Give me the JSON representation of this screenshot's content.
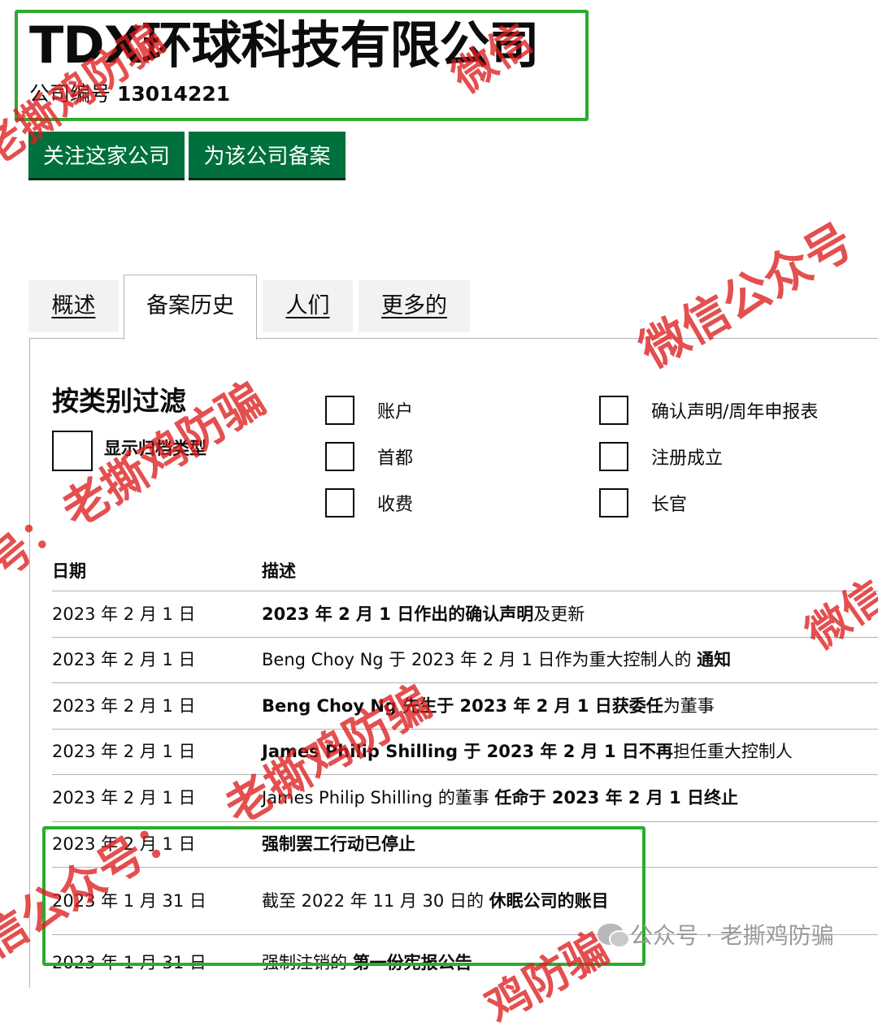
{
  "company": {
    "name": "TDX环球科技有限公司",
    "number_label": "公司编号",
    "number": "13014221"
  },
  "actions": {
    "follow_label": "关注这家公司",
    "file_label": "为该公司备案"
  },
  "tabs": [
    {
      "label": "概述",
      "active": false
    },
    {
      "label": "备案历史",
      "active": true
    },
    {
      "label": "人们",
      "active": false
    },
    {
      "label": "更多的",
      "active": false
    }
  ],
  "filter": {
    "title": "按类别过滤",
    "show_archive_label": "显示归档类型",
    "categories": [
      "账户",
      "首都",
      "收费",
      "确认声明/周年申报表",
      "注册成立",
      "长官"
    ]
  },
  "table": {
    "headers": {
      "date": "日期",
      "description": "描述"
    },
    "rows": [
      {
        "date": "2023 年 2 月 1 日",
        "bold": "2023 年 2 月 1 日作出的确认声明",
        "normal": "及更新"
      },
      {
        "date": "2023 年 2 月 1 日",
        "normal": "Beng Choy Ng 于 2023 年 2 月 1 日作为重大控制人的 ",
        "bold": "通知"
      },
      {
        "date": "2023 年 2 月 1 日",
        "bold": "Beng Choy Ng 先生于 2023 年 2 月 1 日获委任",
        "normal": "为董事"
      },
      {
        "date": "2023 年 2 月 1 日",
        "bold": "James Philip Shilling 于 2023 年 2 月 1 日不再",
        "normal": "担任重大控制人"
      },
      {
        "date": "2023 年 2 月 1 日",
        "normal": "James Philip Shilling 的董事 ",
        "bold": "任命于 2023 年 2 月 1 日终止"
      },
      {
        "date": "2023 年 2 月 1 日",
        "bold": "强制罢工行动已停止",
        "normal": ""
      },
      {
        "date": "2023 年 1 月 31 日",
        "normal": "截至 2022 年 11 月 30 日的 ",
        "bold": "休眠公司的账目"
      },
      {
        "date": "2023 年 1 月 31 日",
        "normal": "强制注销的 ",
        "bold": "第一份宪报公告"
      }
    ]
  },
  "watermarks": {
    "line_a": "老撕鸡防骗",
    "line_b": "微信公众号",
    "line_c": "微信",
    "line_d": "号：",
    "line_e": "微信公众号：老撕鸡防骗",
    "line_f": "信公众号：",
    "line_g": "鸡防骗",
    "line_h": "微信"
  },
  "brand": {
    "text": "公众号 · 老撕鸡防骗"
  },
  "colors": {
    "highlight": "#2dab2d",
    "button": "#00703c",
    "watermark": "#dc1e1e"
  }
}
